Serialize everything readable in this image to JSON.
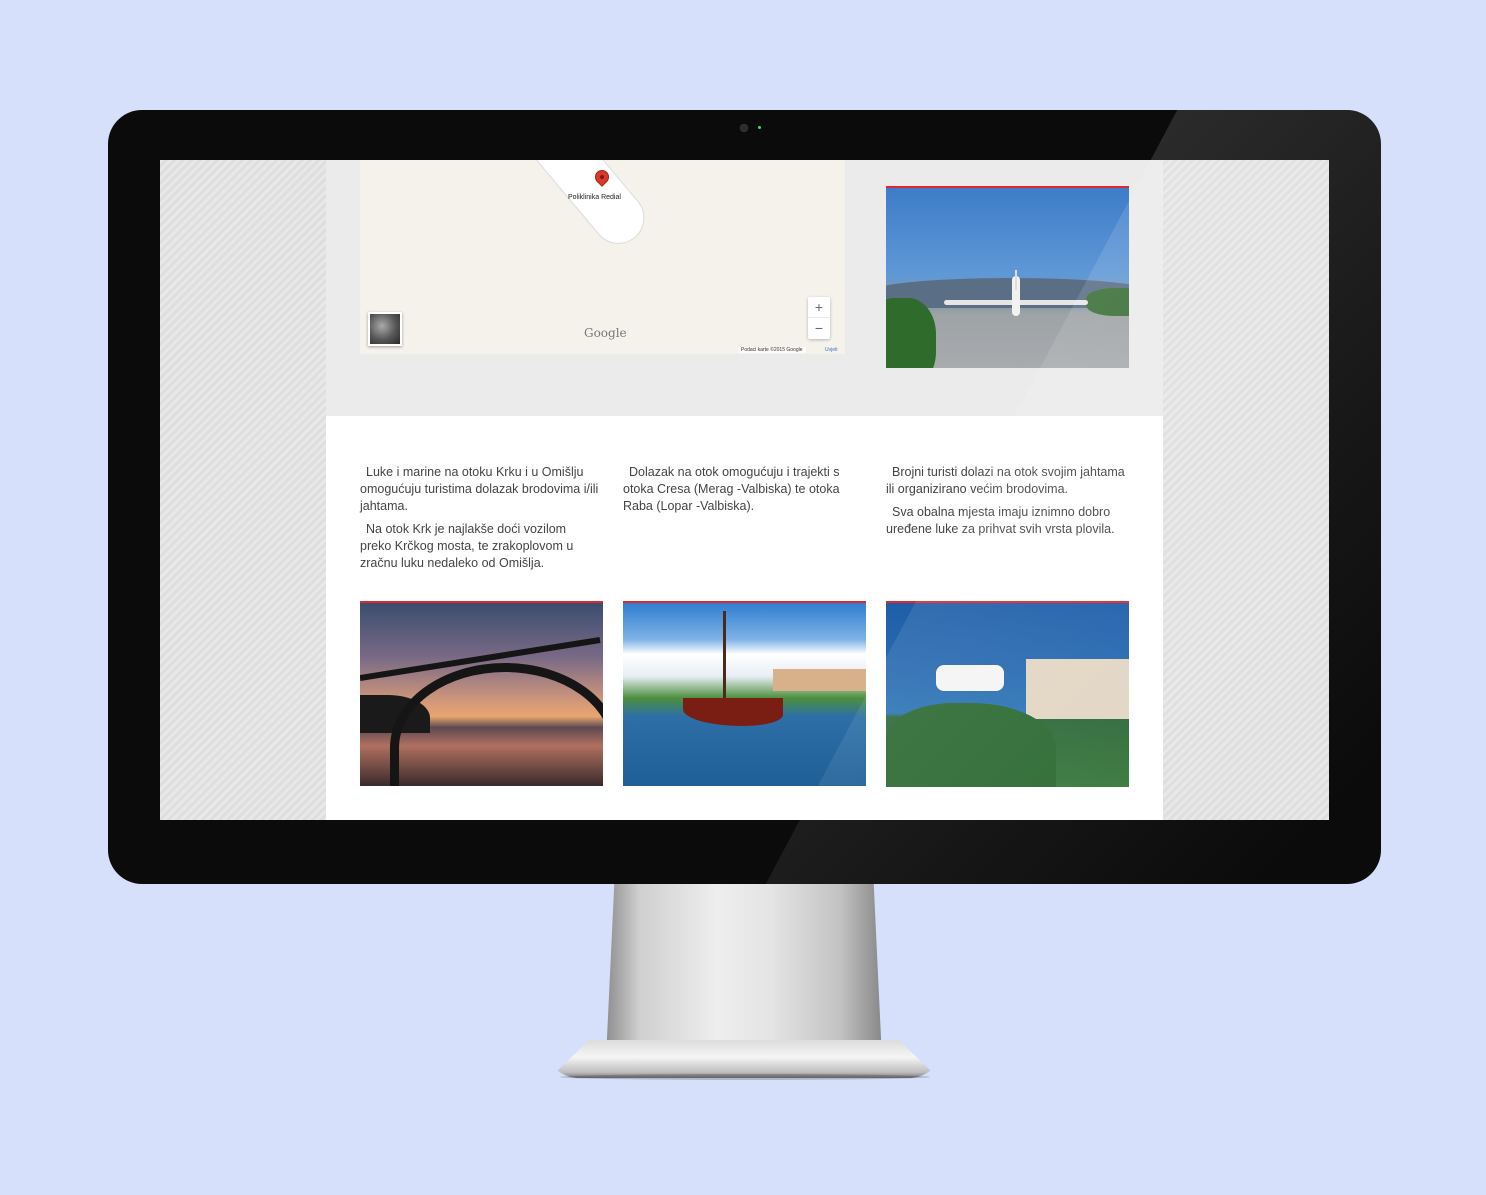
{
  "map": {
    "marker_label": "Poliklinika Redial",
    "zoom_in": "+",
    "zoom_out": "−",
    "logo": "Google",
    "attribution": "Podaci karte ©2015 Google",
    "terms": "Uvjeti"
  },
  "columns": [
    {
      "paragraphs": [
        "Luke i marine na otoku Krku i u Omišlju omogućuju turistima dolazak brodovima i/ili jahtama.",
        "Na otok Krk je najlakše doći vozilom preko Krčkog mosta, te zrakoplovom u zračnu luku nedaleko od Omišlja."
      ]
    },
    {
      "paragraphs": [
        "Dolazak na otok omogućuju i trajekti s otoka Cresa (Merag -Valbiska) te otoka Raba (Lopar -Valbiska)."
      ]
    },
    {
      "paragraphs": [
        "Brojni turisti dolazi na otok svojim jahtama ili organizirano većim brodovima.",
        "Sva obalna mjesta imaju iznimno dobro uređene luke za prihvat svih vrsta plovila."
      ]
    }
  ],
  "colors": {
    "background": "#d6e0fb",
    "accent": "#e2262c",
    "bezel": "#0b0b0b"
  }
}
